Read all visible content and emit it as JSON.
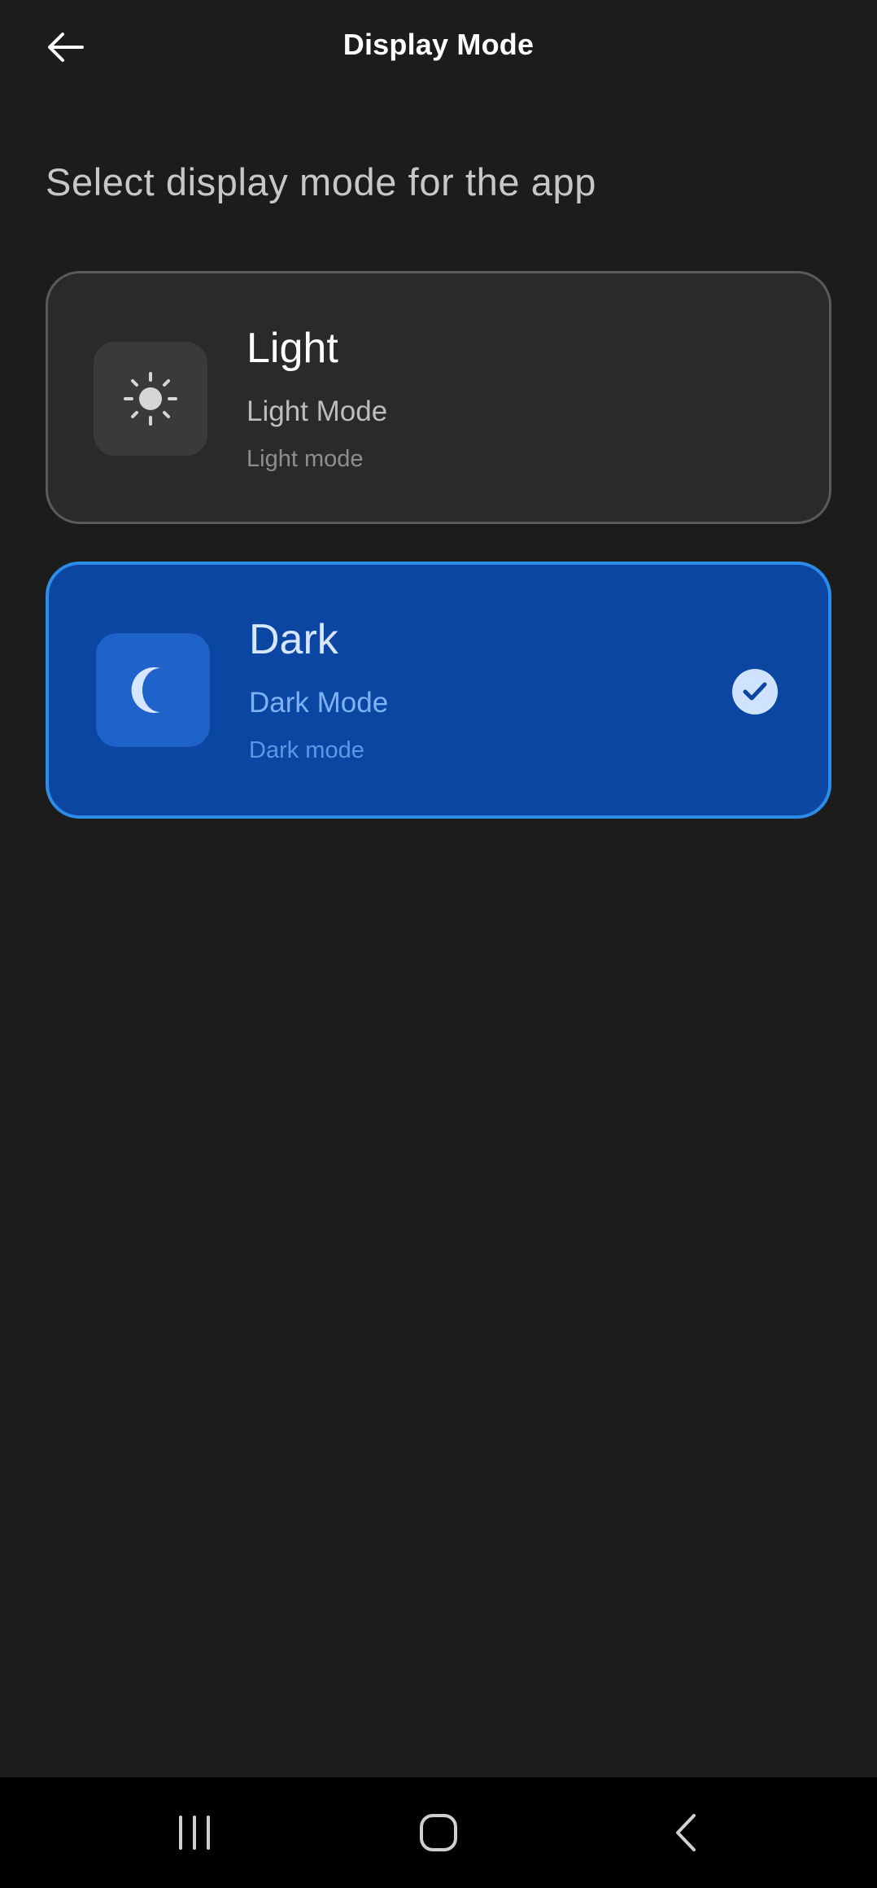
{
  "header": {
    "title": "Display Mode",
    "back_icon": "arrow-left-icon"
  },
  "subtitle": "Select display mode for the app",
  "options": [
    {
      "title": "Light",
      "subtitle": "Light Mode",
      "description": "Light mode",
      "icon": "sun-icon",
      "selected": false
    },
    {
      "title": "Dark",
      "subtitle": "Dark Mode",
      "description": "Dark mode",
      "icon": "moon-icon",
      "selected": true
    }
  ],
  "nav_bar": {
    "recents_icon": "recents-icon",
    "home_icon": "home-icon",
    "back_icon": "chevron-left-icon"
  },
  "colors": {
    "background": "#1c1c1c",
    "selected_card": "#0b46a3",
    "selected_border": "#2b8de8",
    "unselected_card": "#2a2a2a"
  }
}
